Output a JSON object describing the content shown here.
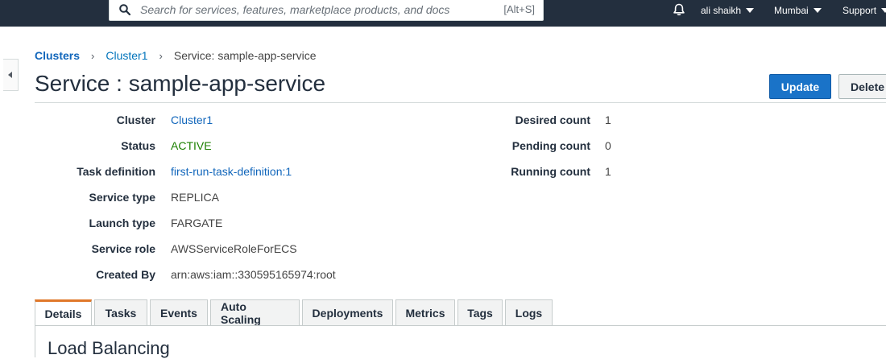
{
  "topnav": {
    "search_placeholder": "Search for services, features, marketplace products, and docs",
    "search_shortcut": "[Alt+S]",
    "user_label": "ali shaikh",
    "region_label": "Mumbai",
    "support_label": "Support"
  },
  "breadcrumb": {
    "clusters": "Clusters",
    "cluster": "Cluster1",
    "current": "Service: sample-app-service"
  },
  "title": "Service : sample-app-service",
  "buttons": {
    "update": "Update",
    "delete": "Delete"
  },
  "details_left": [
    {
      "label": "Cluster",
      "value": "Cluster1"
    },
    {
      "label": "Status",
      "value": "ACTIVE"
    },
    {
      "label": "Task definition",
      "value": "first-run-task-definition:1"
    },
    {
      "label": "Service type",
      "value": "REPLICA"
    },
    {
      "label": "Launch type",
      "value": "FARGATE"
    },
    {
      "label": "Service role",
      "value": "AWSServiceRoleForECS"
    },
    {
      "label": "Created By",
      "value": "arn:aws:iam::330595165974:root"
    }
  ],
  "details_right": [
    {
      "label": "Desired count",
      "value": "1"
    },
    {
      "label": "Pending count",
      "value": "0"
    },
    {
      "label": "Running count",
      "value": "1"
    }
  ],
  "tabs": [
    "Details",
    "Tasks",
    "Events",
    "Auto Scaling",
    "Deployments",
    "Metrics",
    "Tags",
    "Logs"
  ],
  "selected_tab": "Details",
  "section_title": "Load Balancing",
  "colors": {
    "nav_bg": "#232f3e",
    "link": "#1166bb",
    "status_active": "#1d8102",
    "primary_button": "#1a73c8",
    "tab_accent": "#e0782a"
  }
}
